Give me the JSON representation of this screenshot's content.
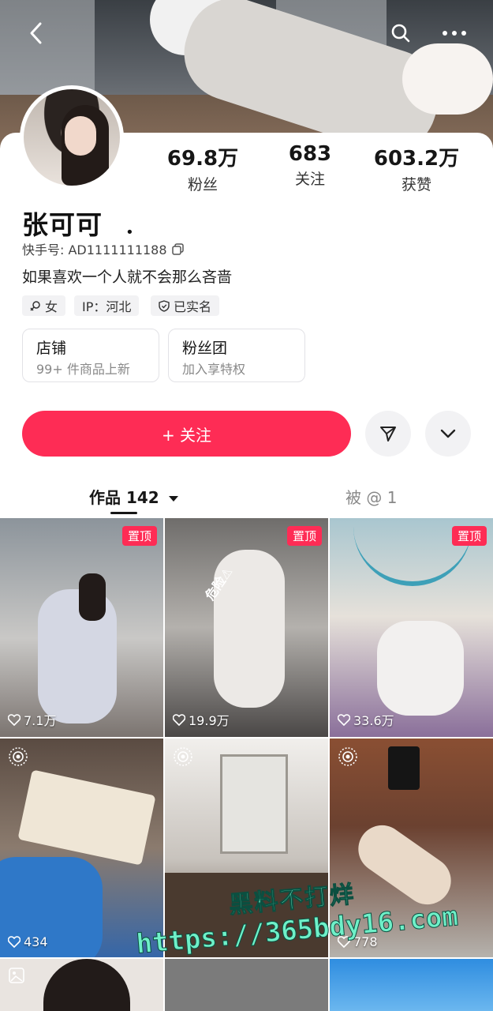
{
  "profile": {
    "name": "张可可",
    "name_suffix": "．",
    "uid_label": "快手号: AD1111111188",
    "bio": "如果喜欢一个人就不会那么吝啬",
    "tags": [
      "女",
      "IP：河北",
      "已实名"
    ]
  },
  "stats": [
    {
      "value": "69.8万",
      "label": "粉丝"
    },
    {
      "value": "683",
      "label": "关注"
    },
    {
      "value": "603.2万",
      "label": "获赞"
    }
  ],
  "entries": [
    {
      "title": "店铺",
      "subtitle": "99+ 件商品上新"
    },
    {
      "title": "粉丝团",
      "subtitle": "加入享特权"
    }
  ],
  "actions": {
    "follow_label": "+ 关注"
  },
  "tabs": {
    "works": "作品 142",
    "mentions": "被 @ 1"
  },
  "grid": {
    "pinned_label": "置顶",
    "items": [
      {
        "likes": "7.1万",
        "pinned": true
      },
      {
        "likes": "19.9万",
        "pinned": true,
        "sticker": "危险⚠"
      },
      {
        "likes": "33.6万",
        "pinned": true
      },
      {
        "likes": "434",
        "pinned": false
      },
      {
        "likes": "",
        "pinned": false
      },
      {
        "likes": "778",
        "pinned": false
      }
    ]
  },
  "watermark": {
    "line1": "黑料不打烊",
    "line2": "https://365bdy16.com"
  },
  "colors": {
    "accent": "#fe2c55",
    "watermark": "#6ff0c8"
  }
}
